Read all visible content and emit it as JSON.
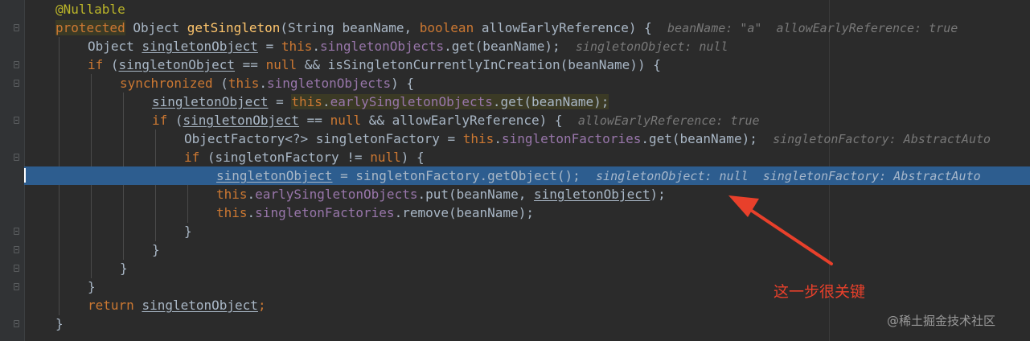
{
  "code": {
    "annotation": "@Nullable",
    "kw_protected": "protected",
    "type_object": "Object",
    "method_name": "getSingleton",
    "params_open": "(String beanName, ",
    "kw_boolean": "boolean",
    "params_close": " allowEarlyReference) {",
    "hint_line2": "beanName: \"a\"  allowEarlyReference: true",
    "l3_type": "Object ",
    "var_singletonObject": "singletonObject",
    "l3_eq": " = ",
    "kw_this": "this",
    "dot": ".",
    "fld_singletonObjects": "singletonObjects",
    "l3_rest": ".get(beanName);",
    "hint_line3": "singletonObject: null",
    "kw_if": "if",
    "l4_open": " (",
    "l4_eqnull": " == ",
    "kw_null": "null",
    "l4_rest": " && isSingletonCurrentlyInCreation(beanName)) {",
    "kw_synchronized": "synchronized",
    "l5_paren": " (",
    "l5_rest": ") {",
    "fld_earlySingletonObjects": "earlySingletonObjects",
    "l6_rest": ".get(beanName);",
    "l7_rest": " && allowEarlyReference) {",
    "hint_line7": "allowEarlyReference: true",
    "l8_decl": "ObjectFactory<?> singletonFactory = ",
    "fld_singletonFactories": "singletonFactories",
    "l8_rest": ".get(beanName);",
    "hint_line8": "singletonFactory: AbstractAuto",
    "l9_open": " (singletonFactory != ",
    "l9_rest": ") {",
    "l10_rest": " = singletonFactory.getObject();",
    "hint_line10": "singletonObject: null  singletonFactory: AbstractAuto",
    "l11_mid": ".put(beanName, ",
    "l11_end": ");",
    "l12_rest": ".remove(beanName);",
    "brace_close": "}",
    "kw_return": "return",
    "semicolon": ";"
  },
  "annotation_note": "这一步很关键",
  "watermark": "@稀土掘金技术社区",
  "colors": {
    "background": "#2b2b2b",
    "keyword": "#cc7832",
    "method": "#ffc66d",
    "field": "#9876aa",
    "annotation": "#bbb529",
    "highlight": "#2d5d8f",
    "arrow": "#e8402b"
  }
}
